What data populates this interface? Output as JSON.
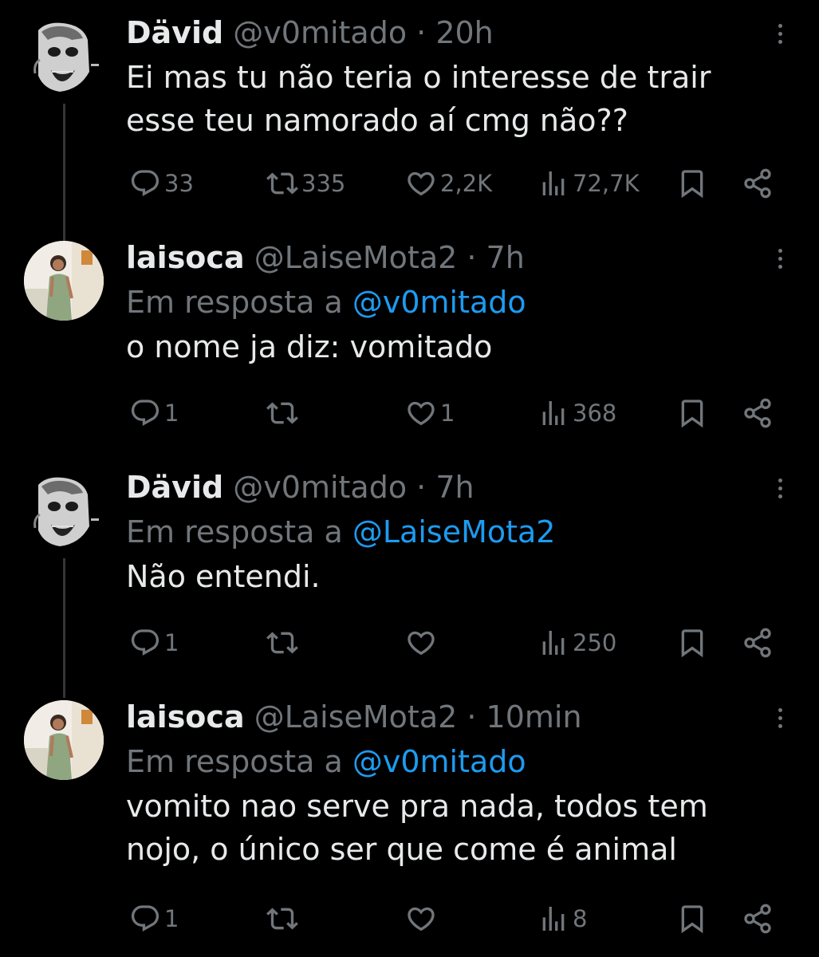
{
  "tweets": [
    {
      "name": "Dävid",
      "handle": "@v0mitado",
      "time": "· 20h",
      "reply_prefix": "",
      "reply_mention": "",
      "text": "Ei mas tu não teria o interesse de trair esse teu namorado aí cmg não??",
      "replies": "33",
      "retweets": "335",
      "likes": "2,2K",
      "views": "72,7K"
    },
    {
      "name": "laisoca",
      "handle": "@LaiseMota2",
      "time": "· 7h",
      "reply_prefix": "Em resposta a ",
      "reply_mention": "@v0mitado",
      "text": "o nome ja diz: vomitado",
      "replies": "1",
      "retweets": "",
      "likes": "1",
      "views": "368"
    },
    {
      "name": "Dävid",
      "handle": "@v0mitado",
      "time": "· 7h",
      "reply_prefix": "Em resposta a ",
      "reply_mention": "@LaiseMota2",
      "text": "Não entendi.",
      "replies": "1",
      "retweets": "",
      "likes": "",
      "views": "250"
    },
    {
      "name": "laisoca",
      "handle": "@LaiseMota2",
      "time": "· 10min",
      "reply_prefix": "Em resposta a ",
      "reply_mention": "@v0mitado",
      "text": "vomito nao serve pra nada, todos tem nojo, o único ser que come é animal",
      "replies": "1",
      "retweets": "",
      "likes": "",
      "views": "8"
    }
  ],
  "icons": {
    "reply": "reply-icon",
    "retweet": "retweet-icon",
    "like": "heart-icon",
    "views": "views-icon",
    "bookmark": "bookmark-icon",
    "share": "share-icon",
    "more": "more-icon"
  },
  "colors": {
    "background": "#000000",
    "text": "#e7e9ea",
    "muted": "#71767b",
    "mention": "#1d9bf0",
    "thread_line": "#333639"
  }
}
